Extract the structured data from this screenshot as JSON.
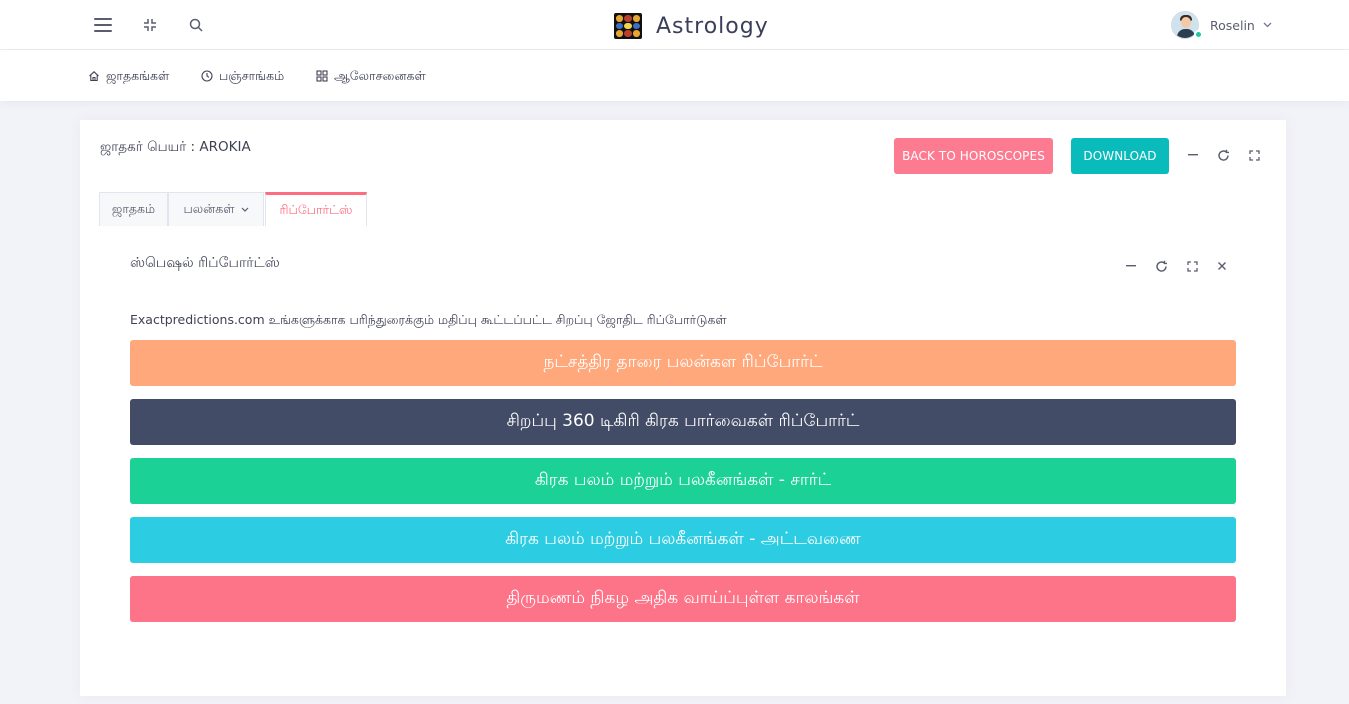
{
  "header": {
    "brand_title": "Astrology",
    "icons": [
      "menu-icon",
      "compress-icon",
      "search-icon"
    ],
    "user": {
      "name": "Roselin",
      "status": "online"
    }
  },
  "subnav": {
    "items": [
      {
        "label": "ஜாதகங்கள்",
        "icon": "home-icon"
      },
      {
        "label": "பஞ்சாங்கம்",
        "icon": "clock-icon"
      },
      {
        "label": "ஆலோசனைகள்",
        "icon": "grid-icon"
      }
    ]
  },
  "card": {
    "title": "ஜாதகர் பெயர் : AROKIA",
    "back_label": "BACK TO HOROSCOPES",
    "download_label": "DOWNLOAD",
    "tabs": [
      {
        "label": "ஜாதகம்",
        "active": false
      },
      {
        "label": "பலன்கள்",
        "active": false,
        "dropdown": true
      },
      {
        "label": "ரிப்போர்ட்ஸ்",
        "active": true
      }
    ]
  },
  "reports": {
    "title": "ஸ்பெஷல் ரிப்போர்ட்ஸ்",
    "intro": "Exactpredictions.com உங்களுக்காக பரிந்துரைக்கும் மதிப்பு கூட்டப்பட்ட சிறப்பு ஜோதிட ரிப்போர்டுகள்",
    "buttons": [
      {
        "label": "நட்சத்திர தாரை பலன்கள ரிப்போர்ட்",
        "color": "#ffa87c"
      },
      {
        "label": "சிறப்பு 360 டிகிரி கிரக பார்வைகள் ரிப்போர்ட்",
        "color": "#434c67"
      },
      {
        "label": "கிரக பலம் மற்றும் பலகீனங்கள் - சார்ட்",
        "color": "#1cd195"
      },
      {
        "label": "கிரக பலம் மற்றும் பலகீனங்கள் - அட்டவணை",
        "color": "#2ccde3"
      },
      {
        "label": "திருமணம் நிகழ அதிக வாய்ப்புள்ள காலங்கள்",
        "color": "#fd7388"
      }
    ]
  }
}
